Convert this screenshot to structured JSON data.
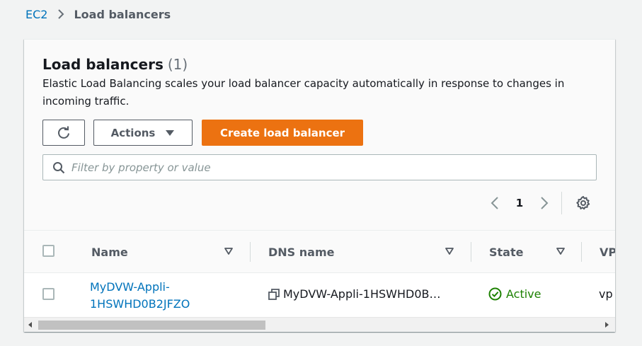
{
  "breadcrumb": {
    "root": "EC2",
    "current": "Load balancers"
  },
  "panel": {
    "title": "Load balancers",
    "count": "(1)",
    "description": "Elastic Load Balancing scales your load balancer capacity automatically in response to changes in incoming traffic."
  },
  "toolbar": {
    "refresh_icon": "refresh-icon",
    "actions_label": "Actions",
    "create_label": "Create load balancer",
    "create_color": "#ec7211"
  },
  "filter": {
    "placeholder": "Filter by property or value",
    "value": ""
  },
  "pagination": {
    "current_page": "1"
  },
  "table": {
    "columns": [
      "Name",
      "DNS name",
      "State",
      "VP"
    ],
    "rows": [
      {
        "name": "MyDVW-Appli-1HSWHD0B2JFZO",
        "dns_name": "MyDVW-Appli-1HSWHD0B…",
        "state": "Active",
        "vpc": "vp"
      }
    ]
  },
  "colors": {
    "link": "#0073bb",
    "active": "#1d8102",
    "header_text": "#545b64"
  }
}
